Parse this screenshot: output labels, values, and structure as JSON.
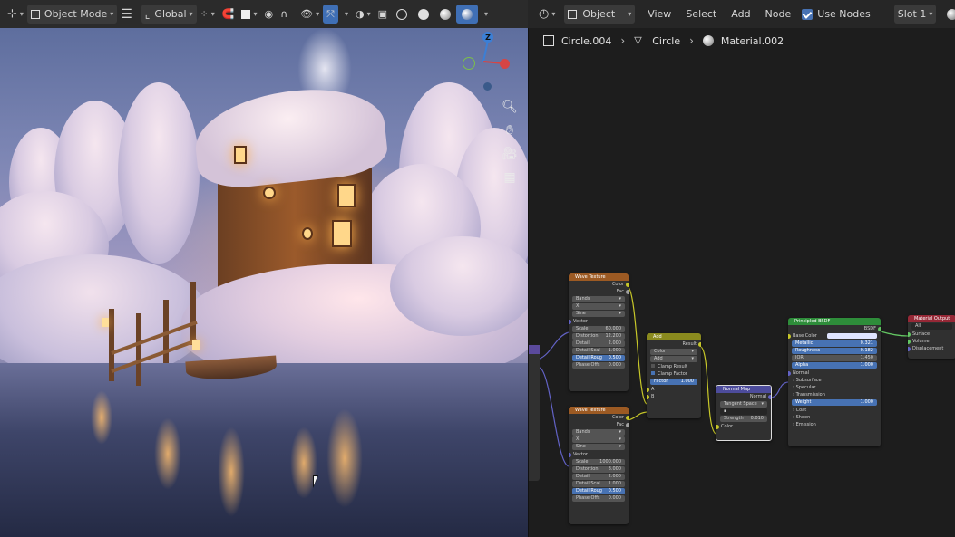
{
  "viewport_header": {
    "mode_label": "Object Mode",
    "transform_orientation": "Global"
  },
  "node_header": {
    "type_label": "Object",
    "menu": [
      "View",
      "Select",
      "Add",
      "Node"
    ],
    "use_nodes_label": "Use Nodes",
    "slot_label": "Slot 1"
  },
  "breadcrumb": {
    "object": "Circle.004",
    "mesh": "Circle",
    "material": "Material.002"
  },
  "gizmo": {
    "z_label": "Z"
  },
  "icons": {
    "editor_type": "editor-type-icon",
    "zoom": "zoom-icon",
    "pan": "hand-icon",
    "camera": "camera-icon",
    "grid": "grid-icon",
    "cursor": "mouse-cursor-icon"
  },
  "colors": {
    "accent_blue": "#4772b3",
    "texture_header": "#9c5a23",
    "converter_header": "#8a8a1e",
    "vector_header": "#4d4c9c",
    "shader_header": "#2e8d3a",
    "output_header": "#962836"
  },
  "nodes": {
    "wave1": {
      "title": "Wave Texture",
      "out_color": "Color",
      "out_fac": "Fac",
      "type": "Bands",
      "axis": "X",
      "profile": "Sine",
      "in_vector": "Vector",
      "fields": [
        {
          "label": "Scale",
          "value": "60.000"
        },
        {
          "label": "Distortion",
          "value": "12.200"
        },
        {
          "label": "Detail",
          "value": "2.000"
        },
        {
          "label": "Detail Scal",
          "value": "1.000"
        },
        {
          "label": "Detail Roug",
          "value": "0.500"
        },
        {
          "label": "Phase Offs",
          "value": "0.000"
        }
      ]
    },
    "wave2": {
      "title": "Wave Texture",
      "out_color": "Color",
      "out_fac": "Fac",
      "type": "Bands",
      "axis": "X",
      "profile": "Sine",
      "in_vector": "Vector",
      "fields": [
        {
          "label": "Scale",
          "value": "1000.000"
        },
        {
          "label": "Distortion",
          "value": "8.000"
        },
        {
          "label": "Detail",
          "value": "2.000"
        },
        {
          "label": "Detail Scal",
          "value": "1.000"
        },
        {
          "label": "Detail Roug",
          "value": "0.500"
        },
        {
          "label": "Phase Offs",
          "value": "0.000"
        }
      ]
    },
    "mix": {
      "title": "Add",
      "out_result": "Result",
      "data_type": "Color",
      "blend": "Add",
      "clamp_result": "Clamp Result",
      "clamp_factor": "Clamp Factor",
      "factor_label": "Factor",
      "factor_value": "1.000",
      "in_a": "A",
      "in_b": "B"
    },
    "normal_map": {
      "title": "Normal Map",
      "out_normal": "Normal",
      "space": "Tangent Space",
      "strength_label": "Strength",
      "strength_value": "0.010",
      "in_color": "Color"
    },
    "bsdf": {
      "title": "Principled BSDF",
      "out_bsdf": "BSDF",
      "base_color": "Base Color",
      "fields": [
        {
          "label": "Metallic",
          "value": "0.321"
        },
        {
          "label": "Roughness",
          "value": "0.182"
        },
        {
          "label": "IOR",
          "value": "1.450"
        },
        {
          "label": "Alpha",
          "value": "1.000"
        }
      ],
      "normal": "Normal",
      "sections": [
        "Subsurface",
        "Specular",
        "Transmission"
      ],
      "weight_label": "Weight",
      "weight_value": "1.000",
      "sections2": [
        "Coat",
        "Sheen",
        "Emission"
      ]
    },
    "output": {
      "title": "Material Output",
      "target": "All",
      "inputs": [
        "Surface",
        "Volume",
        "Displacement"
      ]
    }
  }
}
